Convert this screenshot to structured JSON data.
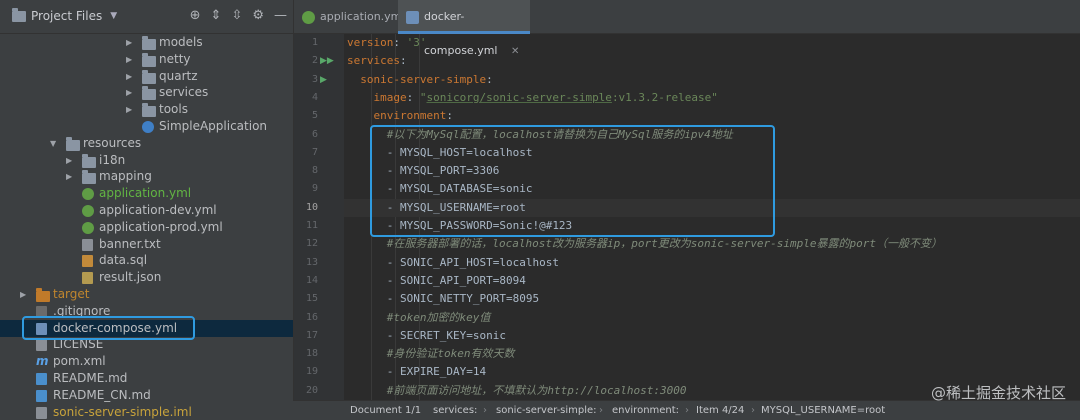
{
  "project_panel": {
    "title": "Project Files",
    "toolbar_icons": [
      "crosshair-icon",
      "expand-all-icon",
      "collapse-all-icon",
      "gear-icon",
      "minimize-icon"
    ]
  },
  "tree": [
    {
      "label": "models",
      "type": "folder",
      "level": 4,
      "expanded": false
    },
    {
      "label": "netty",
      "type": "folder",
      "level": 4,
      "expanded": false
    },
    {
      "label": "quartz",
      "type": "folder",
      "level": 4,
      "expanded": false
    },
    {
      "label": "services",
      "type": "folder",
      "level": 4,
      "expanded": false
    },
    {
      "label": "tools",
      "type": "folder",
      "level": 4,
      "expanded": false
    },
    {
      "label": "SimpleApplication",
      "type": "class",
      "level": 4
    },
    {
      "label": "resources",
      "type": "folder",
      "level": 2,
      "expanded": true
    },
    {
      "label": "i18n",
      "type": "folder",
      "level": 3,
      "expanded": false
    },
    {
      "label": "mapping",
      "type": "folder",
      "level": 3,
      "expanded": false
    },
    {
      "label": "application.yml",
      "type": "spring",
      "level": 3,
      "color": "green"
    },
    {
      "label": "application-dev.yml",
      "type": "spring",
      "level": 3
    },
    {
      "label": "application-prod.yml",
      "type": "spring",
      "level": 3
    },
    {
      "label": "banner.txt",
      "type": "txt",
      "level": 3
    },
    {
      "label": "data.sql",
      "type": "sql",
      "level": 3
    },
    {
      "label": "result.json",
      "type": "json",
      "level": 3
    },
    {
      "label": "target",
      "type": "folder-orange",
      "level": 0,
      "expanded": false,
      "color": "orange"
    },
    {
      "label": ".gitignore",
      "type": "git",
      "level": 0
    },
    {
      "label": "docker-compose.yml",
      "type": "yml",
      "level": 0,
      "selected": true
    },
    {
      "label": "LICENSE",
      "type": "txt",
      "level": 0
    },
    {
      "label": "pom.xml",
      "type": "m",
      "level": 0
    },
    {
      "label": "README.md",
      "type": "md",
      "level": 0
    },
    {
      "label": "README_CN.md",
      "type": "md",
      "level": 0
    },
    {
      "label": "sonic-server-simple.iml",
      "type": "txt",
      "level": 0,
      "color": "yellow"
    }
  ],
  "tabs": [
    {
      "label": "application.yml",
      "active": false
    },
    {
      "label": "docker-compose.yml",
      "active": true
    }
  ],
  "editor": {
    "current_line": 10,
    "lines": [
      {
        "n": "1",
        "text": "version: '3'"
      },
      {
        "n": "2",
        "text": "services:",
        "run": true
      },
      {
        "n": "3",
        "text": "  sonic-server-simple:",
        "run": true
      },
      {
        "n": "4",
        "text": "    image: \"sonicorg/sonic-server-simple:v1.3.2-release\""
      },
      {
        "n": "5",
        "text": "    environment:"
      },
      {
        "n": "6",
        "text": "      #以下为MySql配置，localhost请替换为自己MySql服务的ipv4地址"
      },
      {
        "n": "7",
        "text": "      - MYSQL_HOST=localhost"
      },
      {
        "n": "8",
        "text": "      - MYSQL_PORT=3306"
      },
      {
        "n": "9",
        "text": "      - MYSQL_DATABASE=sonic"
      },
      {
        "n": "10",
        "text": "      - MYSQL_USERNAME=root"
      },
      {
        "n": "11",
        "text": "      - MYSQL_PASSWORD=Sonic!@#123"
      },
      {
        "n": "12",
        "text": "      #在服务器部署的话，localhost改为服务器ip，port更改为sonic-server-simple暴露的port（一般不变）"
      },
      {
        "n": "13",
        "text": "      - SONIC_API_HOST=localhost"
      },
      {
        "n": "14",
        "text": "      - SONIC_API_PORT=8094"
      },
      {
        "n": "15",
        "text": "      - SONIC_NETTY_PORT=8095"
      },
      {
        "n": "16",
        "text": "      #token加密的key值"
      },
      {
        "n": "17",
        "text": "      - SECRET_KEY=sonic"
      },
      {
        "n": "18",
        "text": "      #身份验证token有效天数"
      },
      {
        "n": "19",
        "text": "      - EXPIRE_DAY=14"
      },
      {
        "n": "20",
        "text": "      #前端页面访问地址，不填默认为http://localhost:3000"
      }
    ]
  },
  "statusbar": {
    "items": [
      "Document 1/1",
      "services:",
      "sonic-server-simple:",
      "environment:",
      "Item 4/24",
      "MYSQL_USERNAME=root"
    ]
  },
  "watermark": "@稀土掘金技术社区"
}
